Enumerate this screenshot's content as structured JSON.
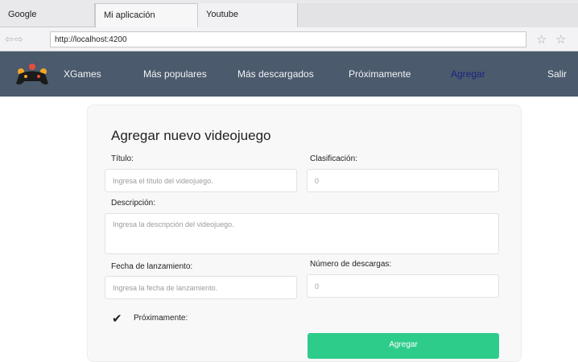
{
  "browser": {
    "tabs": [
      "Google",
      "Mi aplicación",
      "Youtube"
    ],
    "url": "http://localhost:4200"
  },
  "navbar": {
    "brand": "XGames",
    "links": [
      "Más populares",
      "Más descargados",
      "Próximamente",
      "Agregar",
      "Salir"
    ],
    "active_link": "Agregar",
    "active_color": "#1a237e",
    "background": "#4b5a6c"
  },
  "form": {
    "title": "Agregar nuevo videojuego",
    "titulo_label": "Título:",
    "titulo_placeholder": "Ingresa el título del videojuego.",
    "clasificacion_label": "Clasificación:",
    "clasificacion_value": "0",
    "descripcion_label": "Descripción:",
    "descripcion_placeholder": "Ingresa la descripción del videojuego.",
    "fecha_label": "Fecha de lanzamiento:",
    "fecha_placeholder": "Ingresa la fecha de lanzamiento.",
    "descargas_label": "Número de descargas:",
    "descargas_value": "0",
    "proximamente_label": "Próximamente:",
    "proximamente_checked": true,
    "submit_label": "Agregar",
    "submit_color": "#2ecc8b"
  }
}
